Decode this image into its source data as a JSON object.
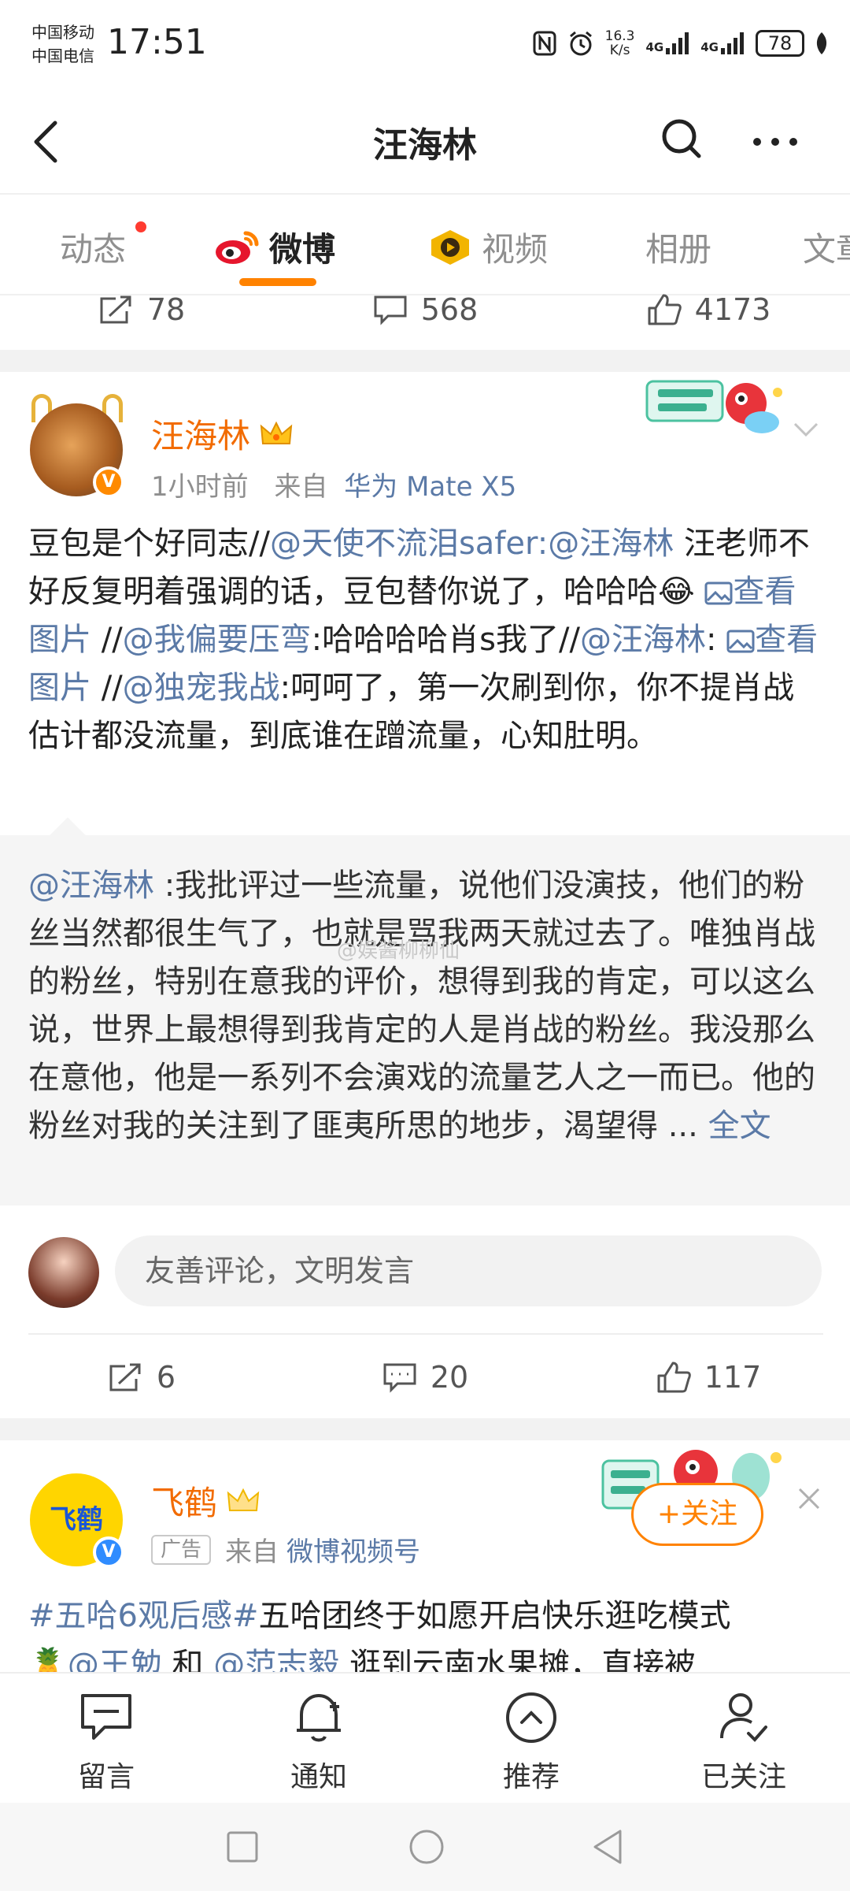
{
  "status_bar": {
    "carrier_1": "中国移动",
    "carrier_2": "中国电信",
    "time": "17:51",
    "net_speed_value": "16.3",
    "net_speed_unit": "K/s",
    "net_1": "4G",
    "net_2": "4G",
    "battery": "78"
  },
  "header": {
    "title": "汪海林"
  },
  "tabs": [
    {
      "label": "动态",
      "has_dot": true
    },
    {
      "label": "微博",
      "active": true
    },
    {
      "label": "视频"
    },
    {
      "label": "相册"
    },
    {
      "label": "文章"
    }
  ],
  "prev_actions": {
    "reposts": "78",
    "comments": "568",
    "likes": "4173"
  },
  "post": {
    "author": "汪海林",
    "time": "1小时前",
    "source_prefix": "来自",
    "source": "华为 Mate X5",
    "text": {
      "p1": "豆包是个好同志//",
      "m1": "@天使不流泪safer:",
      "m2": "@汪海林",
      "p2": " 汪老师不好反复明着强调的话，豆包替你说了，哈哈哈",
      "emoji": "😂",
      "img1": "查看图片",
      "p3": " //",
      "m3": "@我偏要压弯",
      "p4": ":哈哈哈哈肖s我了//",
      "m4": "@汪海林",
      "p5": ": ",
      "img2": "查看图片",
      "p6": " //",
      "m5": "@独宠我战",
      "p7": ":呵呵了，第一次刷到你，你不提肖战估计都没流量，到底谁在蹭流量，心知肚明。"
    },
    "repost": {
      "mention": "@汪海林",
      "text": " :我批评过一些流量，说他们没演技，他们的粉丝当然都很生气了，也就是骂我两天就过去了。唯独肖战的粉丝，特别在意我的评价，想得到我的肯定，可以这么说，世界上最想得到我肯定的人是肖战的粉丝。我没那么在意他，他是一系列不会演戏的流量艺人之一而已。他的粉丝对我的关注到了匪夷所思的地步，渴望得 ... ",
      "full_text": "全文",
      "watermark": "@娱酱柳柳仙"
    },
    "comment_placeholder": "友善评论，文明发言",
    "actions": {
      "reposts": "6",
      "comments": "20",
      "likes": "117"
    }
  },
  "post2": {
    "logo_text": "飞鹤",
    "author": "飞鹤",
    "ad_label": "广告",
    "source_prefix": "来自",
    "source": "微博视频号",
    "follow": "+关注",
    "hashtag": "#五哈6观后感#",
    "text": "五哈团终于如愿开启快乐逛吃模式",
    "line2_emoji": "🍍",
    "m1": "@王勉",
    "p1": " 和 ",
    "m2": "@范志毅",
    "p2": " 逛到云南水果摊，直接被"
  },
  "bottom_nav": [
    {
      "label": "留言"
    },
    {
      "label": "通知"
    },
    {
      "label": "推荐"
    },
    {
      "label": "已关注"
    }
  ],
  "colors": {
    "accent": "#ff8200",
    "link": "#5b7aa7",
    "author": "#f26b00"
  }
}
